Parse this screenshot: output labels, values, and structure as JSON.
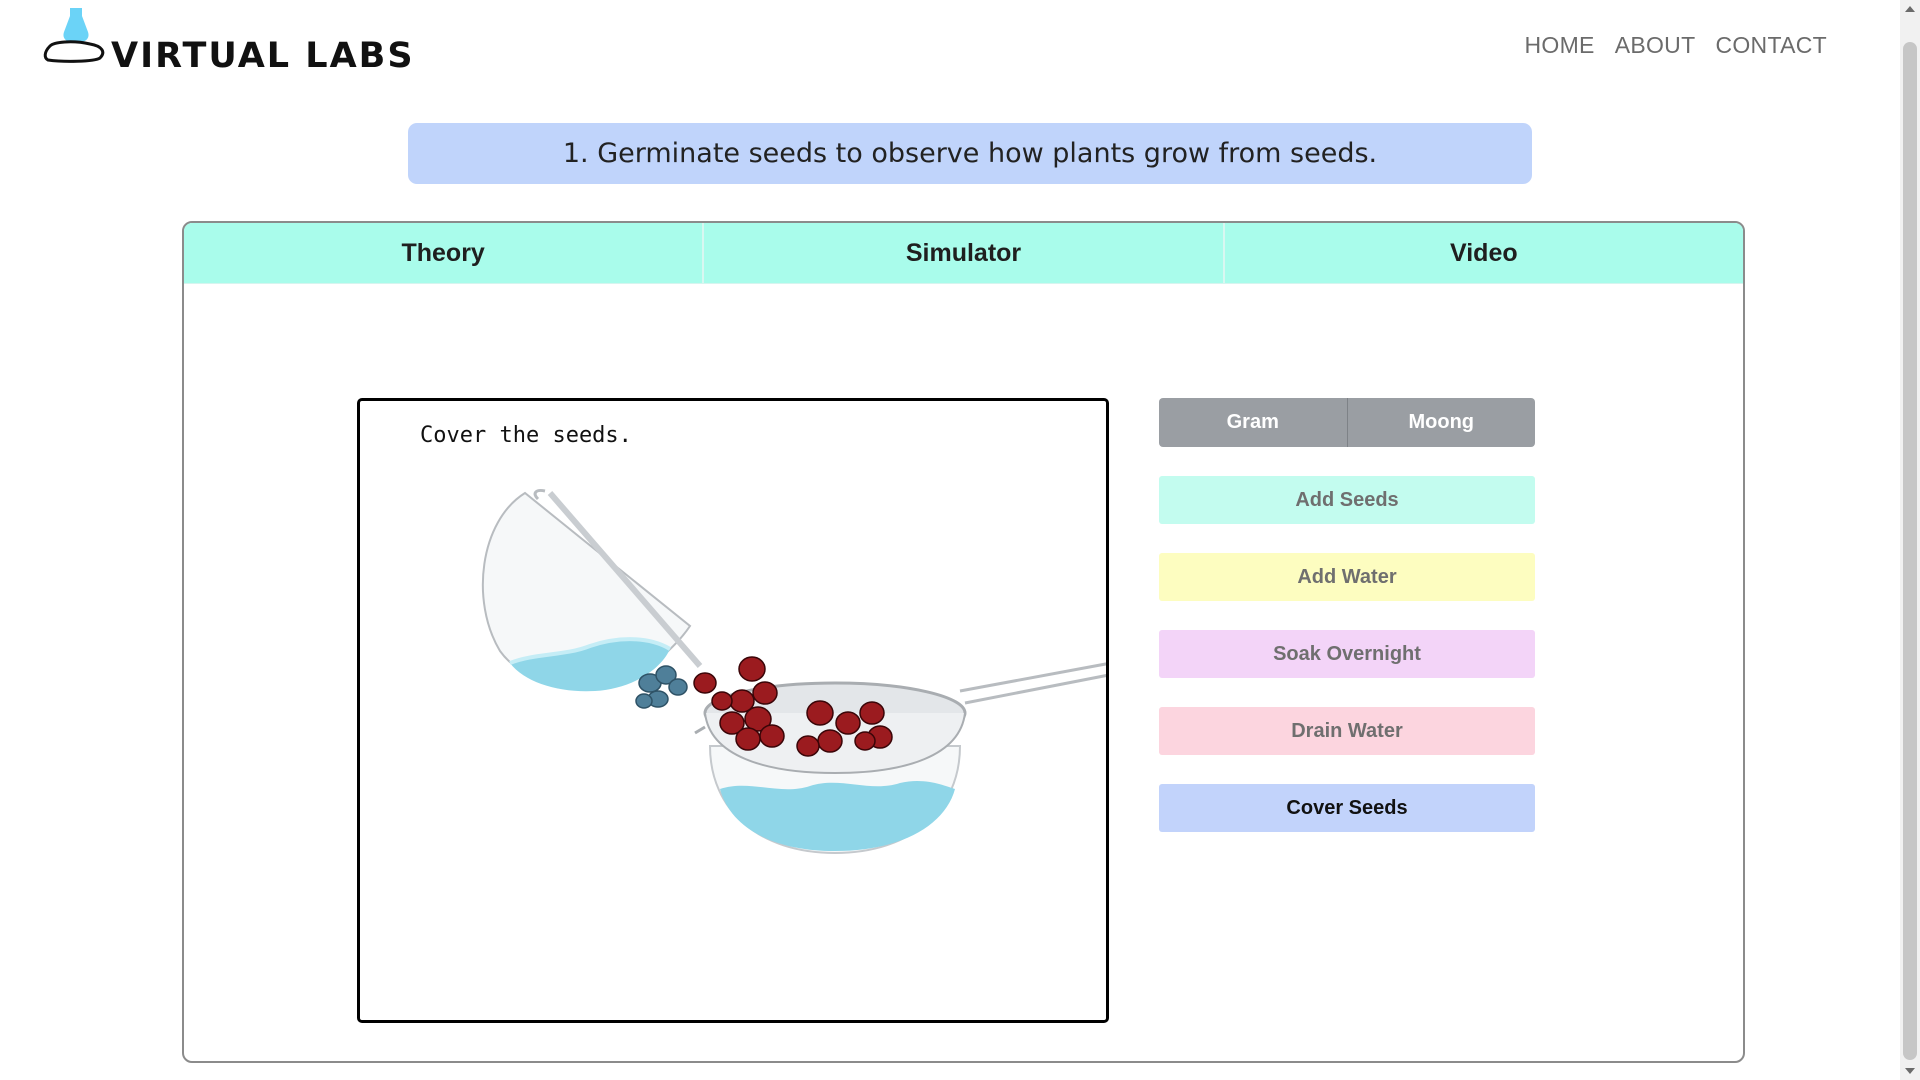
{
  "header": {
    "logo_text": "VIRTUAL LABS",
    "nav": [
      {
        "label": "HOME"
      },
      {
        "label": "ABOUT"
      },
      {
        "label": "CONTACT"
      }
    ]
  },
  "experiment": {
    "title": "1. Germinate seeds to observe how plants grow from seeds."
  },
  "tabs": [
    {
      "label": "Theory"
    },
    {
      "label": "Simulator"
    },
    {
      "label": "Video"
    }
  ],
  "simulator": {
    "instruction": "Cover the seeds.",
    "seed_types": [
      {
        "label": "Gram"
      },
      {
        "label": "Moong"
      }
    ],
    "actions": {
      "add_seeds": "Add Seeds",
      "add_water": "Add Water",
      "soak_overnight": "Soak Overnight",
      "drain_water": "Drain Water",
      "cover_seeds": "Cover Seeds"
    }
  },
  "colors": {
    "tab_bg": "#a9fceb",
    "banner_bg": "#c0d4fb",
    "add_seeds_bg": "#c3fcef",
    "add_water_bg": "#fdfdc0",
    "soak_bg": "#f3d4f8",
    "drain_bg": "#fcd5df",
    "cover_bg": "#c2d3fb",
    "seed_type_bg": "#9a9ea3"
  }
}
